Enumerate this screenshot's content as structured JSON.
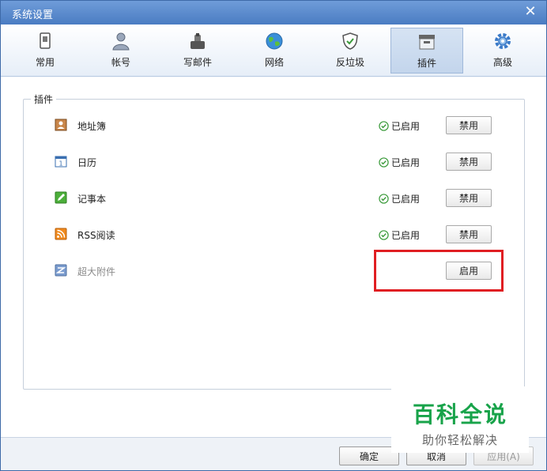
{
  "window": {
    "title": "系统设置",
    "close_symbol": "✕"
  },
  "toolbar": {
    "items": [
      {
        "label": "常用",
        "icon": "general-icon"
      },
      {
        "label": "帐号",
        "icon": "account-icon"
      },
      {
        "label": "写邮件",
        "icon": "compose-icon"
      },
      {
        "label": "网络",
        "icon": "network-icon"
      },
      {
        "label": "反垃圾",
        "icon": "antispam-shield-icon"
      },
      {
        "label": "插件",
        "icon": "plugin-icon",
        "active": true
      },
      {
        "label": "高级",
        "icon": "advanced-gear-icon"
      }
    ]
  },
  "plugins": {
    "group_title": "插件",
    "status_enabled": "已启用",
    "items": [
      {
        "name": "地址簿",
        "icon": "addressbook-icon",
        "enabled": true,
        "button": "禁用"
      },
      {
        "name": "日历",
        "icon": "calendar-icon",
        "enabled": true,
        "button": "禁用"
      },
      {
        "name": "记事本",
        "icon": "notepad-icon",
        "enabled": true,
        "button": "禁用"
      },
      {
        "name": "RSS阅读",
        "icon": "rss-icon",
        "enabled": true,
        "button": "禁用"
      },
      {
        "name": "超大附件",
        "icon": "large-attachment-icon",
        "enabled": false,
        "button": "启用"
      }
    ]
  },
  "footer": {
    "ok": "确定",
    "cancel": "取消",
    "apply": "应用(A)"
  },
  "watermark": {
    "line1": "百科全说",
    "line2": "助你轻松解决"
  },
  "colors": {
    "titlebar": "#4a7cc2",
    "highlight": "#e01e22",
    "watermark": "#18a34a"
  }
}
